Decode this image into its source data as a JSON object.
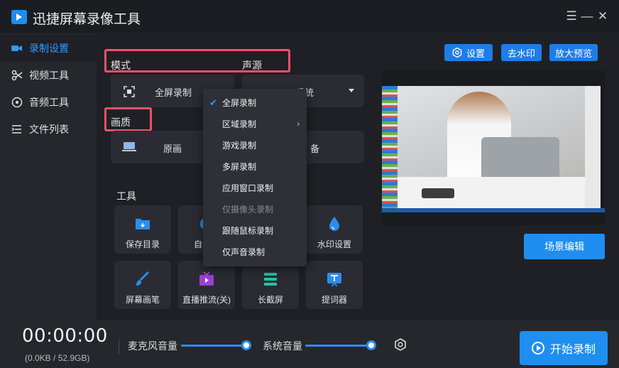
{
  "app": {
    "title": "迅捷屏幕录像工具"
  },
  "window_controls": {
    "menu": "☰",
    "minimize": "—",
    "close": "✕"
  },
  "sidebar": {
    "items": [
      {
        "label": "录制设置",
        "icon": "video-camera-icon",
        "active": true
      },
      {
        "label": "视频工具",
        "icon": "scissors-icon",
        "active": false
      },
      {
        "label": "音频工具",
        "icon": "audio-disc-icon",
        "active": false
      },
      {
        "label": "文件列表",
        "icon": "file-list-icon",
        "active": false
      }
    ]
  },
  "settings": {
    "mode_label": "模式",
    "source_label": "声源",
    "mode_value": "全屏录制",
    "source_value": "系统",
    "quality_label": "画质",
    "quality_value": "原画",
    "output_value": "备"
  },
  "tools": {
    "title": "工具",
    "items": [
      {
        "label": "保存目录",
        "icon": "folder-icon"
      },
      {
        "label": "自动停",
        "icon": "clock-icon"
      },
      {
        "label": "水印设置",
        "icon": "water-drop-icon"
      },
      {
        "label": "屏幕画笔",
        "icon": "brush-icon"
      },
      {
        "label": "直播推流(关)",
        "icon": "tv-stream-icon"
      },
      {
        "label": "长截屏",
        "icon": "long-screenshot-icon"
      },
      {
        "label": "提词器",
        "icon": "teleprompter-icon"
      }
    ]
  },
  "top_buttons": {
    "settings": "设置",
    "remove_watermark": "去水印",
    "zoom_preview": "放大预览"
  },
  "scene_button": "场景编辑",
  "dropdown": {
    "items": [
      {
        "label": "全屏录制",
        "checked": true,
        "disabled": false,
        "submenu": false
      },
      {
        "label": "区域录制",
        "checked": false,
        "disabled": false,
        "submenu": true
      },
      {
        "label": "游戏录制",
        "checked": false,
        "disabled": false,
        "submenu": false
      },
      {
        "label": "多屏录制",
        "checked": false,
        "disabled": false,
        "submenu": false
      },
      {
        "label": "应用窗口录制",
        "checked": false,
        "disabled": false,
        "submenu": false
      },
      {
        "label": "仅摄像头录制",
        "checked": false,
        "disabled": true,
        "submenu": false
      },
      {
        "label": "跟随鼠标录制",
        "checked": false,
        "disabled": false,
        "submenu": false
      },
      {
        "label": "仅声音录制",
        "checked": false,
        "disabled": false,
        "submenu": false
      }
    ],
    "check_glyph": "✔",
    "submenu_glyph": "›"
  },
  "bottom": {
    "timer": "00:00:00",
    "size": "(0.0KB / 52.9GB)",
    "mic_label": "麦克风音量",
    "system_label": "系统音量",
    "mic_volume": 1.0,
    "system_volume": 1.0,
    "start_label": "开始录制"
  },
  "colors": {
    "accent": "#1e8ef0",
    "highlight": "#f25068",
    "background": "#1f2025"
  }
}
